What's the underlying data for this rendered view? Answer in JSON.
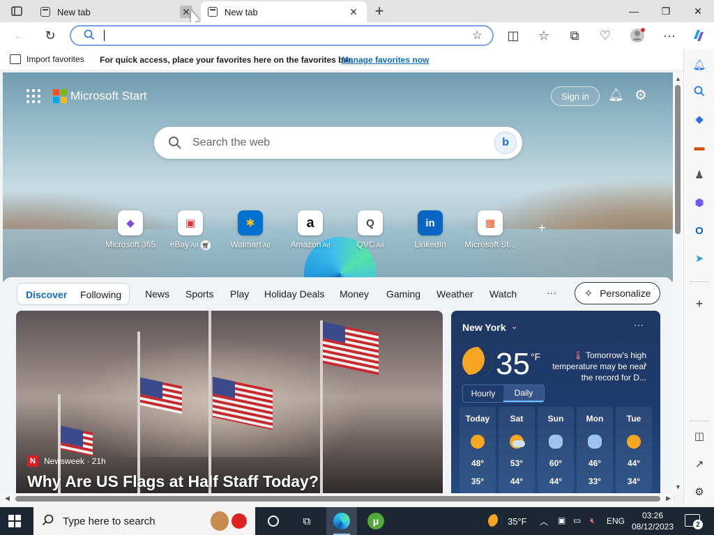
{
  "browser": {
    "tabs": [
      {
        "title": "New tab",
        "active": false
      },
      {
        "title": "New tab",
        "active": true
      }
    ],
    "address": {
      "value": "",
      "placeholder": ""
    },
    "favorites_bar": {
      "import_label": "Import favorites",
      "message": "For quick access, place your favorites here on the favorites bar.",
      "manage_link": "Manage favorites now"
    }
  },
  "start_page": {
    "brand": "Microsoft Start",
    "sign_in": "Sign in",
    "search_placeholder": "Search the web",
    "quick_links": [
      {
        "label": "Microsoft 365",
        "ad": "",
        "glyph": "◆",
        "color": "#7b4de0"
      },
      {
        "label": "eBay",
        "ad": "Ad",
        "glyph": "▣",
        "color": "#e53238"
      },
      {
        "label": "Walmart",
        "ad": "Ad",
        "glyph": "✱",
        "color": "#0071ce"
      },
      {
        "label": "Amazon",
        "ad": "Ad",
        "glyph": "a",
        "color": "#111111"
      },
      {
        "label": "QVC",
        "ad": "Ad",
        "glyph": "Q",
        "color": "#444444"
      },
      {
        "label": "LinkedIn",
        "ad": "",
        "glyph": "in",
        "color": "#0a66c2"
      },
      {
        "label": "Microsoft St...",
        "ad": "",
        "glyph": "▦",
        "color": "#f25022"
      }
    ],
    "nav": {
      "discover": "Discover",
      "following": "Following",
      "items": [
        "News",
        "Sports",
        "Play",
        "Holiday Deals",
        "Money",
        "Gaming",
        "Weather",
        "Watch"
      ],
      "more": "···",
      "personalize": "Personalize"
    },
    "hero_card": {
      "source_logo": "N",
      "source": "Newsweek · 21h",
      "headline": "Why Are US Flags at Half Staff Today?"
    },
    "weather": {
      "city": "New York",
      "temp": "35",
      "unit": "°F",
      "alert": "Tomorrow's high temperature may be near the record for D...",
      "toggle_hourly": "Hourly",
      "toggle_daily": "Daily",
      "days": [
        {
          "name": "Today",
          "high": "48°",
          "low": "35°",
          "icon": "sunny-icon"
        },
        {
          "name": "Sat",
          "high": "53°",
          "low": "44°",
          "icon": "partly-cloudy-icon"
        },
        {
          "name": "Sun",
          "high": "60°",
          "low": "44°",
          "icon": "rain-icon"
        },
        {
          "name": "Mon",
          "high": "46°",
          "low": "33°",
          "icon": "rain-sun-icon"
        },
        {
          "name": "Tue",
          "high": "44°",
          "low": "34°",
          "icon": "sunny-icon"
        }
      ]
    }
  },
  "taskbar": {
    "search_placeholder": "Type here to search",
    "weather_temp": "35°F",
    "language": "ENG",
    "time": "03:26",
    "date": "08/12/2023",
    "notifications": "2"
  },
  "colors": {
    "accent": "#0f6cbd",
    "taskbar": "#1d2733",
    "weather_bg": "#1f3763"
  }
}
